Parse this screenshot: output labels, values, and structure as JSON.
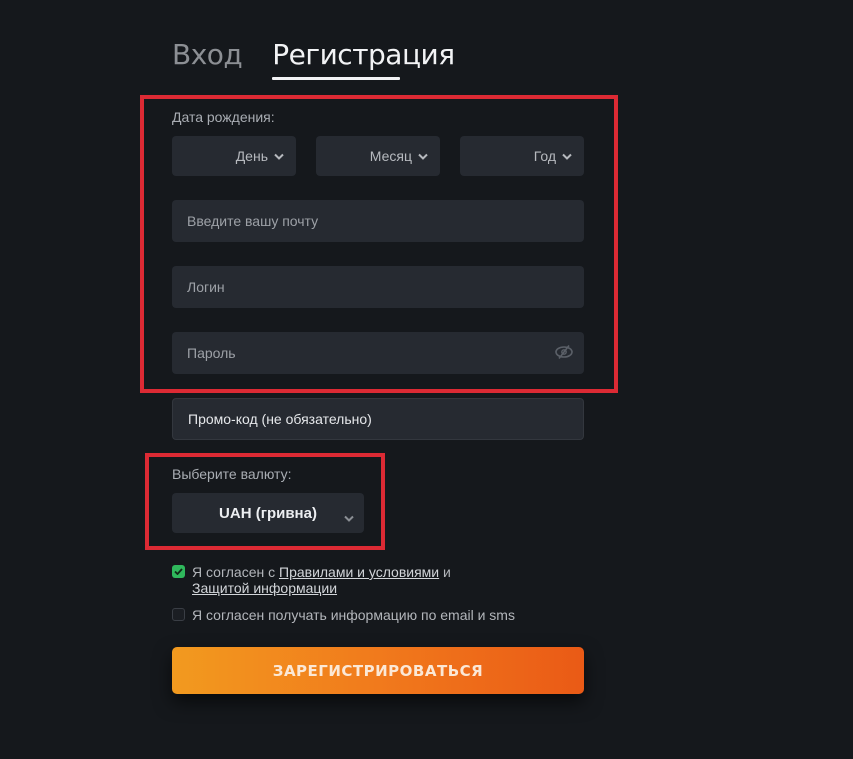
{
  "tabs": {
    "login": "Вход",
    "register": "Регистрация",
    "active": "register"
  },
  "form": {
    "birth_label": "Дата рождения:",
    "day": "День",
    "month": "Месяц",
    "year": "Год",
    "email_placeholder": "Введите вашу почту",
    "login_placeholder": "Логин",
    "password_placeholder": "Пароль",
    "promo_placeholder": "Промо-код (не обязательно)",
    "currency_label": "Выберите валюту:",
    "currency_value": "UAH (гривна)",
    "agree_prefix": "Я согласен с ",
    "agree_link1": "Правилами и условиями",
    "agree_mid": " и",
    "agree_link2": "Защитой информации",
    "agree_checked": true,
    "newsletter": "Я согласен получать информацию по email и sms",
    "newsletter_checked": false,
    "submit": "ЗАРЕГИСТРИРОВАТЬСЯ"
  },
  "colors": {
    "accent_start": "#f29a1f",
    "accent_end": "#ea5a16",
    "highlight": "#dc2a34",
    "check": "#2fb85c"
  }
}
